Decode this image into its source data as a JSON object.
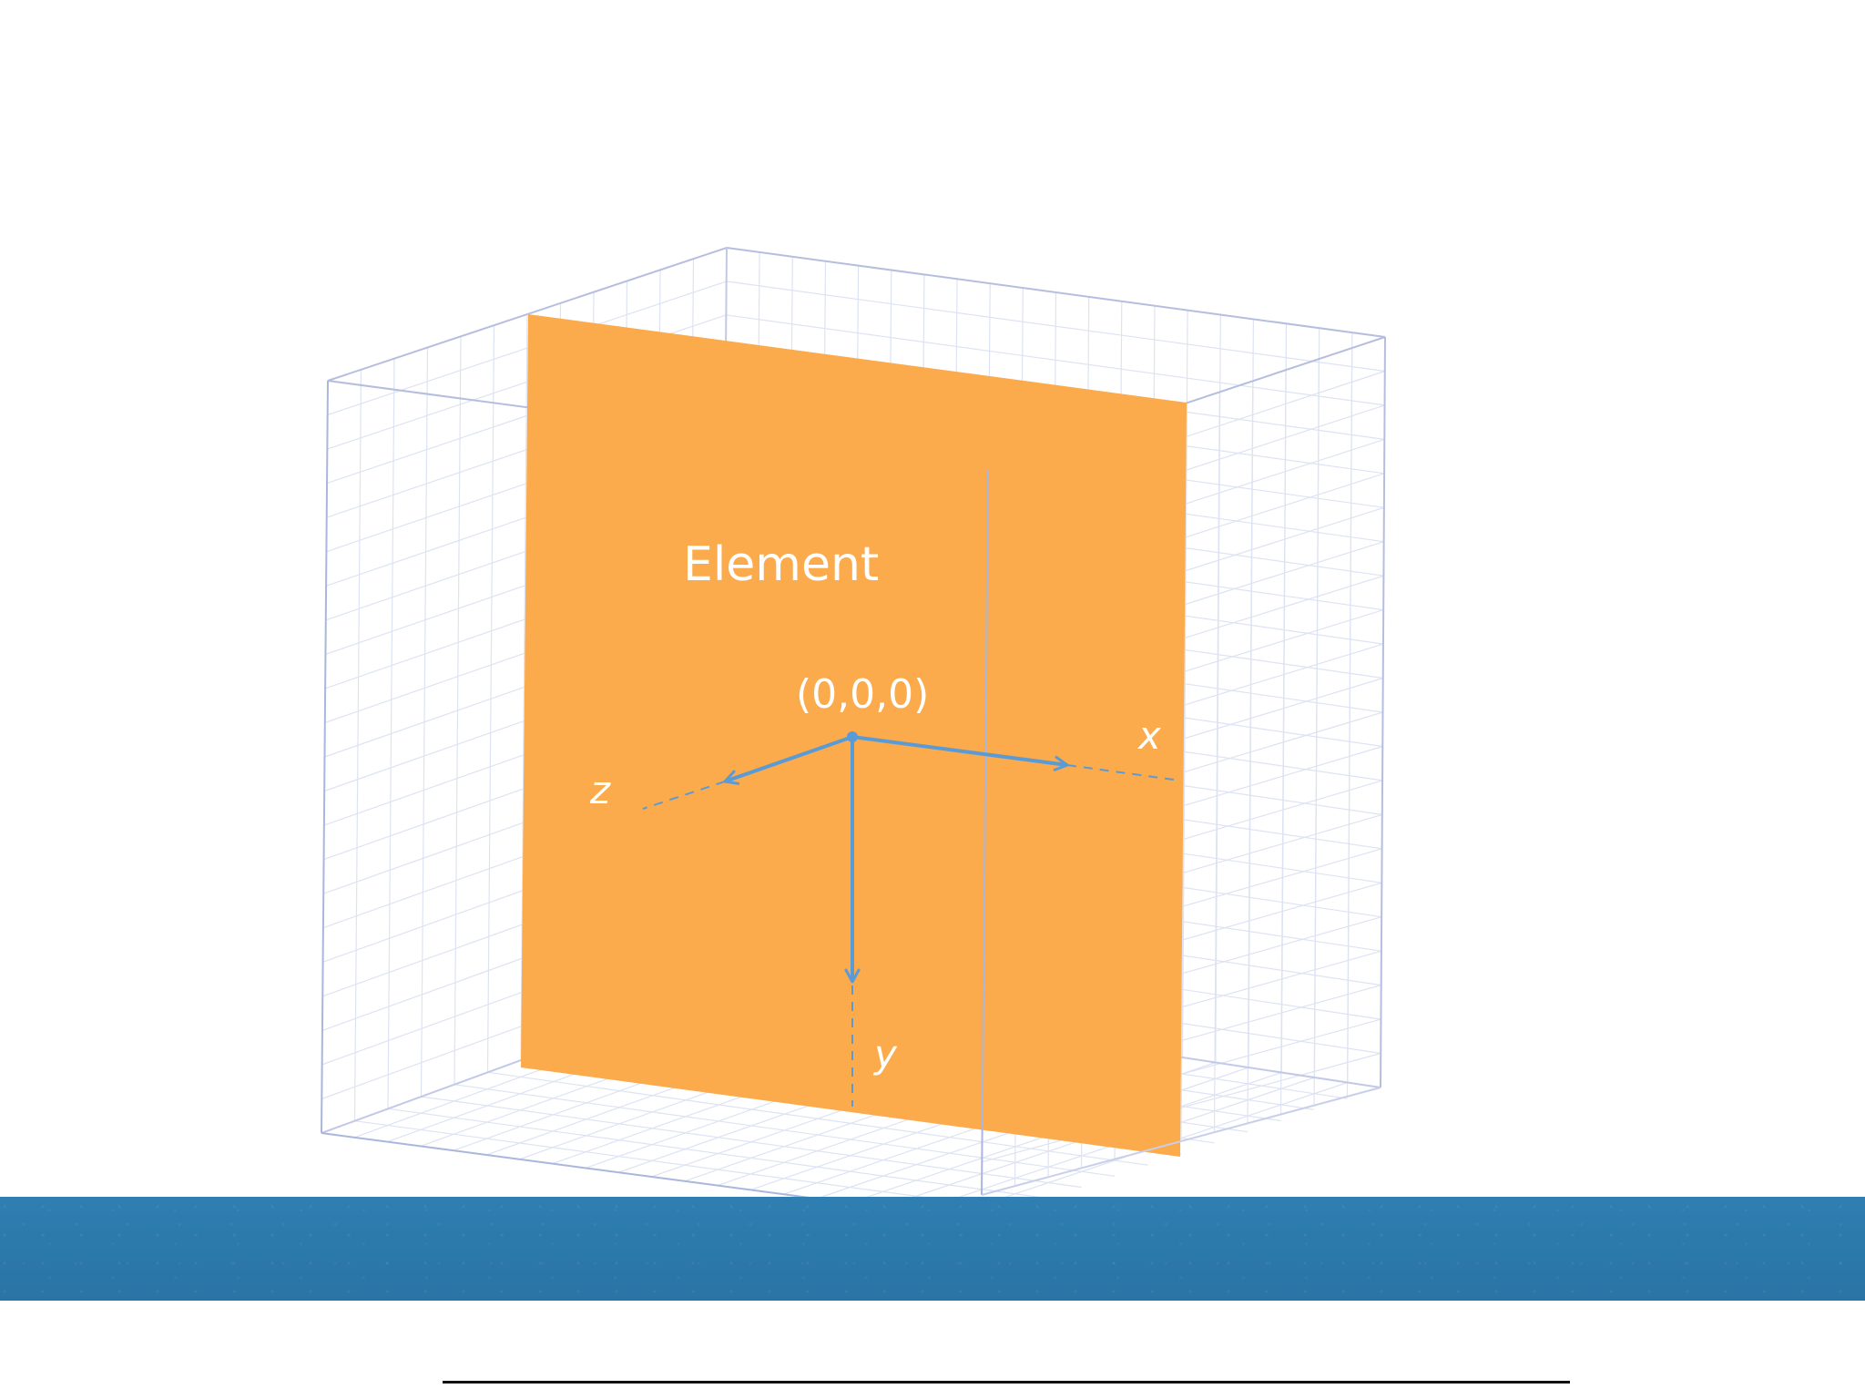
{
  "diagram": {
    "element_label": "Element",
    "origin_label": "(0,0,0)",
    "axis_x_label": "x",
    "axis_y_label": "y",
    "axis_z_label": "z"
  },
  "colors": {
    "element_fill": "#fbaa4c",
    "axis_color": "#5b9bd5",
    "box_edge": "#aab6dc",
    "grid_line": "#dde3f2",
    "banner": "#2c78aa",
    "rule": "#111111"
  }
}
